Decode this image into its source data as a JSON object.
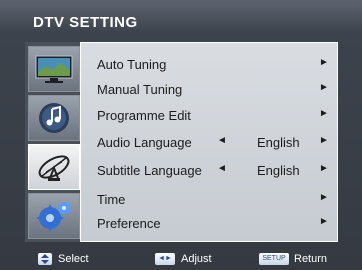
{
  "title": "DTV SETTING",
  "menu": [
    {
      "label": "Auto Tuning",
      "value": "",
      "left_arrow": "",
      "right_arrow": "►"
    },
    {
      "label": "Manual Tuning",
      "value": "",
      "left_arrow": "",
      "right_arrow": "►"
    },
    {
      "label": "Programme Edit",
      "value": "",
      "left_arrow": "",
      "right_arrow": "►"
    },
    {
      "label": "Audio Language",
      "value": "English",
      "left_arrow": "◄",
      "right_arrow": "►"
    },
    {
      "label": "Subtitle Language",
      "value": "English",
      "left_arrow": "◄",
      "right_arrow": "►"
    },
    {
      "label": "Time",
      "value": "",
      "left_arrow": "",
      "right_arrow": "►"
    },
    {
      "label": "Preference",
      "value": "",
      "left_arrow": "",
      "right_arrow": "►"
    }
  ],
  "tabs": [
    {
      "icon": "tv-icon",
      "active": false
    },
    {
      "icon": "music-note-icon",
      "active": false
    },
    {
      "icon": "satellite-dish-icon",
      "active": true
    },
    {
      "icon": "gears-icon",
      "active": false
    }
  ],
  "footer": {
    "select_label": "Select",
    "adjust_key": "◄►",
    "adjust_label": "Adjust",
    "setup_key": "SETUP",
    "return_label": "Return"
  }
}
